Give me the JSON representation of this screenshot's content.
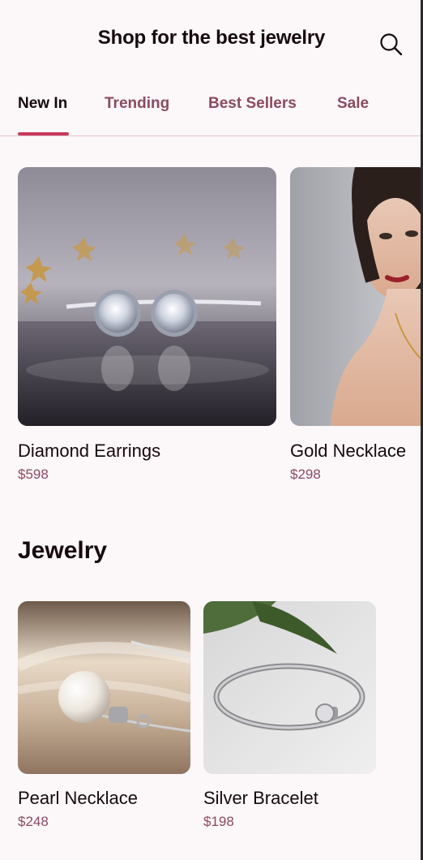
{
  "header": {
    "title": "Shop for the best jewelry",
    "search_icon": "search-icon"
  },
  "tabs": [
    {
      "label": "New In",
      "active": true
    },
    {
      "label": "Trending",
      "active": false
    },
    {
      "label": "Best Sellers",
      "active": false
    },
    {
      "label": "Sale",
      "active": false
    }
  ],
  "featured": [
    {
      "name": "Diamond Earrings",
      "price": "$598"
    },
    {
      "name": "Gold Necklace",
      "price": "$298"
    }
  ],
  "jewelry": {
    "title": "Jewelry",
    "items": [
      {
        "name": "Pearl Necklace",
        "price": "$248"
      },
      {
        "name": "Silver Bracelet",
        "price": "$198"
      }
    ]
  },
  "colors": {
    "background": "#fcf7f8",
    "accent": "#c73a5a",
    "muted_text": "#8a4a62",
    "primary_text": "#16090f"
  }
}
